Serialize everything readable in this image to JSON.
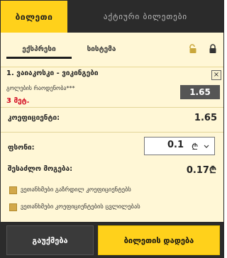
{
  "tabs": {
    "betslip": "ბილეთი",
    "active": "აქტიური ბილეთები"
  },
  "subtabs": {
    "express": "ექსპრესი",
    "system": "სისტემა"
  },
  "selection": {
    "match": "1. ვაიაკოსკი - ვიკინგები",
    "market": "გოლების რაოდენობა***",
    "pick": "3 მეტ.",
    "odds": "1.65"
  },
  "coefficient": {
    "label": "კოეფიციენტი:",
    "value": "1.65"
  },
  "stake": {
    "label": "ფსონი:",
    "value": "0.1",
    "currency": "₾"
  },
  "payout": {
    "label": "შესაძლო მოგება:",
    "value": "0.17",
    "currency": "₾"
  },
  "options": [
    "ვეთანხმები გაზრდილ კოეფიციენტებს",
    "ვეთანხმები კოეფიციენტების ცვლილებას"
  ],
  "buttons": {
    "clear": "გაუქმება",
    "place": "ბილეთის დადება"
  },
  "icons": {
    "unlock": "unlock-icon",
    "lock": "lock-icon",
    "close": "close-icon",
    "chevron": "chevron-down-icon"
  },
  "colors": {
    "accent": "#ffd11b",
    "dark": "#2b2b2b",
    "panel": "#fff7d6",
    "danger": "#d3061d"
  }
}
